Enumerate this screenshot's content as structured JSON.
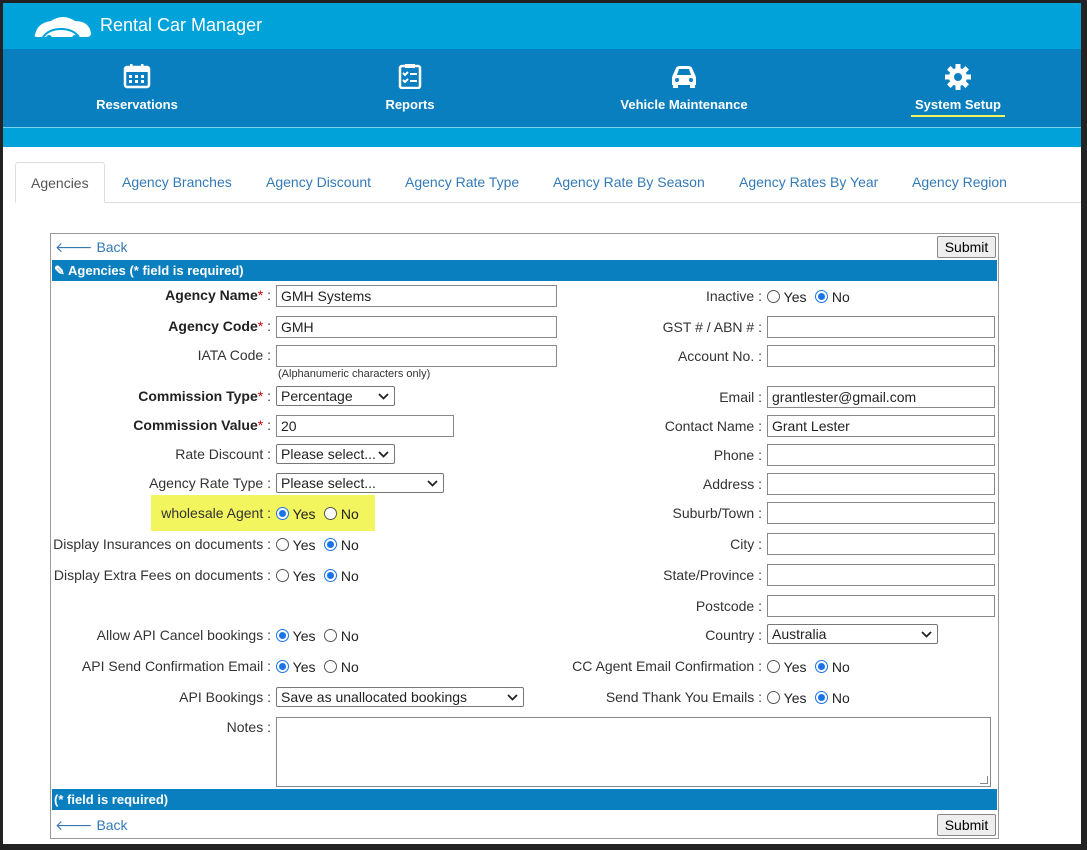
{
  "app": {
    "title": "Rental Car Manager"
  },
  "nav": [
    {
      "label": "Reservations",
      "icon": "calendar-icon"
    },
    {
      "label": "Reports",
      "icon": "checklist-icon"
    },
    {
      "label": "Vehicle Maintenance",
      "icon": "car-icon"
    },
    {
      "label": "System Setup",
      "icon": "gear-icon",
      "active": true
    }
  ],
  "tabs": [
    "Agencies",
    "Agency Branches",
    "Agency Discount",
    "Agency Rate Type",
    "Agency Rate By Season",
    "Agency Rates By Year",
    "Agency Region"
  ],
  "form": {
    "back_label": "Back",
    "submit_label": "Submit",
    "header": "Agencies (* field is required)",
    "footer": "(* field is required)",
    "agency_name": {
      "label": "Agency Name",
      "value": "GMH Systems"
    },
    "agency_code": {
      "label": "Agency Code",
      "value": "GMH"
    },
    "iata_code": {
      "label": "IATA Code :",
      "value": "",
      "hint": "(Alphanumeric characters only)"
    },
    "commission_type": {
      "label": "Commission Type",
      "value": "Percentage"
    },
    "commission_value": {
      "label": "Commission Value",
      "value": "20"
    },
    "rate_discount": {
      "label": "Rate Discount :",
      "value": "Please select..."
    },
    "agency_rate_type": {
      "label": "Agency Rate Type :",
      "value": "Please select..."
    },
    "wholesale_agent": {
      "label": "wholesale Agent :",
      "value": "Yes"
    },
    "display_insurances": {
      "label": "Display Insurances on documents :",
      "value": "No"
    },
    "display_extra_fees": {
      "label": "Display Extra Fees on documents :",
      "value": "No"
    },
    "allow_api_cancel": {
      "label": "Allow API Cancel bookings :",
      "value": "Yes"
    },
    "api_send_confirmation": {
      "label": "API Send Confirmation Email :",
      "value": "Yes"
    },
    "api_bookings": {
      "label": "API Bookings :",
      "value": "Save as unallocated bookings"
    },
    "notes": {
      "label": "Notes :",
      "value": ""
    },
    "inactive": {
      "label": "Inactive :",
      "value": "No"
    },
    "gst_abn": {
      "label": "GST # / ABN # :",
      "value": ""
    },
    "account_no": {
      "label": "Account No. :",
      "value": ""
    },
    "email": {
      "label": "Email :",
      "value": "grantlester@gmail.com"
    },
    "contact_name": {
      "label": "Contact Name :",
      "value": "Grant Lester"
    },
    "phone": {
      "label": "Phone :",
      "value": ""
    },
    "address": {
      "label": "Address :",
      "value": ""
    },
    "suburb": {
      "label": "Suburb/Town :",
      "value": ""
    },
    "city": {
      "label": "City :",
      "value": ""
    },
    "state": {
      "label": "State/Province :",
      "value": ""
    },
    "postcode": {
      "label": "Postcode :",
      "value": ""
    },
    "country": {
      "label": "Country :",
      "value": "Australia"
    },
    "cc_agent_email": {
      "label": "CC Agent Email Confirmation :",
      "value": "No"
    },
    "send_thank_you": {
      "label": "Send Thank You Emails :",
      "value": "No"
    },
    "yes_label": "Yes",
    "no_label": "No"
  },
  "colors": {
    "header_blue": "#00a3d9",
    "nav_blue": "#0a7fbf",
    "highlight": "#f3f55f"
  }
}
